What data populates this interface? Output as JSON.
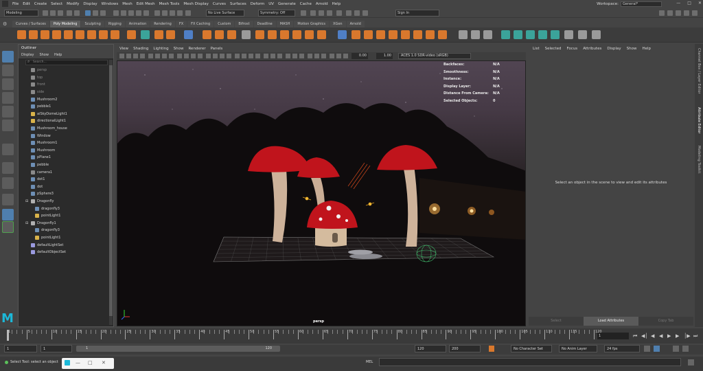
{
  "menubar": {
    "items": [
      "File",
      "Edit",
      "Create",
      "Select",
      "Modify",
      "Display",
      "Windows",
      "Mesh",
      "Edit Mesh",
      "Mesh Tools",
      "Mesh Display",
      "Curves",
      "Surfaces",
      "Deform",
      "UV",
      "Generate",
      "Cache",
      "Arnold",
      "Help"
    ],
    "workspace_label": "Workspace:",
    "workspace_value": "General*"
  },
  "statusline": {
    "mode": "Modeling",
    "live_surface": "No Live Surface",
    "symmetry": "Symmetry: Off",
    "sign_in": "Sign In"
  },
  "shelf_tabs": [
    "Curves / Surfaces",
    "Poly Modeling",
    "Sculpting",
    "Rigging",
    "Animation",
    "Rendering",
    "FX",
    "FX Caching",
    "Custom",
    "Bifrost",
    "Deadline",
    "MASH",
    "Motion Graphics",
    "XGen",
    "Arnold"
  ],
  "shelf_active": "Poly Modeling",
  "outliner": {
    "title": "Outliner",
    "menu": [
      "Display",
      "Show",
      "Help"
    ],
    "search_placeholder": "Search...",
    "items": [
      {
        "label": "persp",
        "type": "camera",
        "dim": true,
        "indent": 0
      },
      {
        "label": "top",
        "type": "camera",
        "dim": true,
        "indent": 0
      },
      {
        "label": "front",
        "type": "camera",
        "dim": true,
        "indent": 0
      },
      {
        "label": "side",
        "type": "camera",
        "dim": true,
        "indent": 0
      },
      {
        "label": "Mushroom2",
        "type": "mesh",
        "indent": 0
      },
      {
        "label": "pebble1",
        "type": "mesh",
        "indent": 0
      },
      {
        "label": "aiSkyDomeLight1",
        "type": "light",
        "indent": 0
      },
      {
        "label": "directionalLight1",
        "type": "light",
        "indent": 0
      },
      {
        "label": "Mushroom_house",
        "type": "mesh",
        "indent": 0
      },
      {
        "label": "Window",
        "type": "mesh",
        "indent": 0
      },
      {
        "label": "Mushroom1",
        "type": "mesh",
        "indent": 0
      },
      {
        "label": "Mushroom",
        "type": "mesh",
        "indent": 0
      },
      {
        "label": "pPlane1",
        "type": "mesh",
        "indent": 0
      },
      {
        "label": "pebble",
        "type": "mesh",
        "indent": 0
      },
      {
        "label": "camera1",
        "type": "camera",
        "indent": 0
      },
      {
        "label": "dot1",
        "type": "mesh",
        "indent": 0
      },
      {
        "label": "dot",
        "type": "mesh",
        "indent": 0
      },
      {
        "label": "pSphere3",
        "type": "mesh",
        "indent": 0
      },
      {
        "label": "Dragonfly",
        "type": "group",
        "indent": 0
      },
      {
        "label": "dragonfly3",
        "type": "mesh",
        "indent": 1
      },
      {
        "label": "pointLight1",
        "type": "light",
        "indent": 1
      },
      {
        "label": "Dragonfly1",
        "type": "group",
        "indent": 0
      },
      {
        "label": "dragonfly3",
        "type": "mesh",
        "indent": 1
      },
      {
        "label": "pointLight1",
        "type": "light",
        "indent": 1
      },
      {
        "label": "defaultLightSet",
        "type": "set",
        "indent": 0
      },
      {
        "label": "defaultObjectSet",
        "type": "set",
        "indent": 0
      }
    ]
  },
  "viewport": {
    "menu": [
      "View",
      "Shading",
      "Lighting",
      "Show",
      "Renderer",
      "Panels"
    ],
    "exposure": "0.00",
    "gamma": "1.00",
    "color_space": "ACES 1.0 SDR-video (sRGB)",
    "camera_label": "persp",
    "hud": [
      {
        "key": "Backfaces:",
        "value": "N/A"
      },
      {
        "key": "Smoothness:",
        "value": "N/A"
      },
      {
        "key": "Instance:",
        "value": "N/A"
      },
      {
        "key": "Display Layer:",
        "value": "N/A"
      },
      {
        "key": "Distance From Camera:",
        "value": "N/A"
      },
      {
        "key": "Selected Objects:",
        "value": "0"
      }
    ]
  },
  "attribute_editor": {
    "menu": [
      "List",
      "Selected",
      "Focus",
      "Attributes",
      "Display",
      "Show",
      "Help"
    ],
    "message": "Select an object in the scene to view and edit its attributes",
    "buttons": [
      "Select",
      "Load Attributes",
      "Copy Tab"
    ]
  },
  "side_tabs": [
    "Channel Box / Layer Editor",
    "Attribute Editor",
    "Modeling Toolkit"
  ],
  "timeslider": {
    "labels": [
      "1",
      "5",
      "10",
      "15",
      "20",
      "25",
      "30",
      "35",
      "40",
      "45",
      "50",
      "55",
      "60",
      "65",
      "70",
      "75",
      "80",
      "85",
      "90",
      "95",
      "100",
      "105",
      "110",
      "115",
      "120"
    ],
    "current_frame": "1"
  },
  "range": {
    "start": "1",
    "anim_start": "1",
    "range_start": "1",
    "range_end": "120",
    "anim_end_a": "120",
    "anim_end_b": "200",
    "character_set": "No Character Set",
    "anim_layer": "No Anim Layer",
    "fps": "24 fps"
  },
  "helpline": {
    "text": "Select Tool: select an object",
    "mel_label": "MEL"
  },
  "colors": {
    "maya_logo": "#1cb8d8",
    "shelf_orange": "#d9782d",
    "shelf_teal": "#3ba39a",
    "cap_red": "#c0141c",
    "stem_beige": "#d2b69a"
  }
}
